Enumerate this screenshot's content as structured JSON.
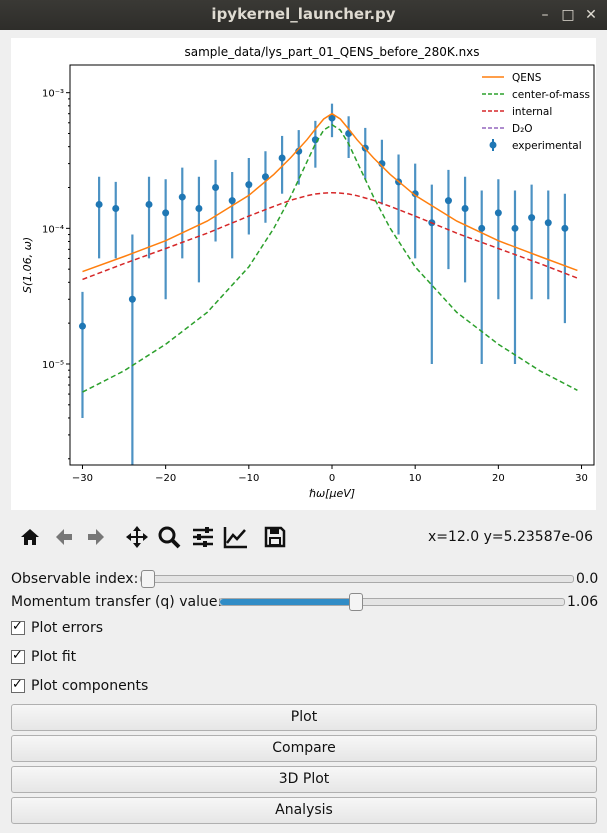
{
  "window": {
    "title": "ipykernel_launcher.py"
  },
  "plot": {
    "title": "sample_data/lys_part_01_QENS_before_280K.nxs",
    "xlabel": "ℏω[μeV]",
    "ylabel": "S(1.06, ω)",
    "legend": [
      {
        "label": "QENS",
        "color": "#ff7f0e",
        "style": "solid"
      },
      {
        "label": "center-of-mass",
        "color": "#2ca02c",
        "style": "dashed"
      },
      {
        "label": "internal",
        "color": "#d62728",
        "style": "dashed"
      },
      {
        "label": "D₂O",
        "color": "#9467bd",
        "style": "dashed"
      },
      {
        "label": "experimental",
        "color": "#1f77b4",
        "style": "marker"
      }
    ],
    "xticks": [
      "−30",
      "−20",
      "−10",
      "0",
      "10",
      "20",
      "30"
    ],
    "yticks": [
      "10⁻³",
      "10⁻⁴",
      "10⁻⁵"
    ]
  },
  "chart_data": {
    "type": "scatter",
    "title": "sample_data/lys_part_01_QENS_before_280K.nxs",
    "xlabel": "ℏω[μeV]",
    "ylabel": "S(1.06, ω)",
    "yscale": "log",
    "xlim": [
      -31.5,
      31.5
    ],
    "ylim": [
      1.8e-06,
      0.0016
    ],
    "grid": false,
    "legend_position": "top-right",
    "series": [
      {
        "name": "QENS",
        "kind": "line",
        "x": [
          -30,
          -25,
          -20,
          -15,
          -10,
          -7,
          -5,
          -3,
          -2,
          -1,
          0,
          1,
          2,
          3,
          5,
          7,
          10,
          15,
          20,
          25,
          29.5
        ],
        "values": [
          4.8e-05,
          6.2e-05,
          8.1e-05,
          0.000113,
          0.000175,
          0.00025,
          0.00033,
          0.00045,
          0.00054,
          0.00064,
          0.0007,
          0.00064,
          0.00054,
          0.00045,
          0.00033,
          0.00025,
          0.000175,
          0.000113,
          8.1e-05,
          6.2e-05,
          4.9e-05
        ]
      },
      {
        "name": "center-of-mass",
        "kind": "line",
        "x": [
          -30,
          -25,
          -20,
          -15,
          -10,
          -7,
          -5,
          -3,
          -2,
          -1,
          0,
          1,
          2,
          3,
          5,
          7,
          10,
          15,
          20,
          25,
          29.5
        ],
        "values": [
          6.2e-06,
          8.9e-06,
          1.4e-05,
          2.4e-05,
          5.2e-05,
          0.0001,
          0.00017,
          0.00031,
          0.00042,
          0.00053,
          0.00058,
          0.00053,
          0.00042,
          0.00031,
          0.00017,
          0.0001,
          5.2e-05,
          2.4e-05,
          1.4e-05,
          8.9e-06,
          6.4e-06
        ]
      },
      {
        "name": "internal",
        "kind": "line",
        "x": [
          -30,
          -25,
          -20,
          -15,
          -10,
          -7,
          -5,
          -3,
          -2,
          -1,
          0,
          1,
          2,
          3,
          5,
          7,
          10,
          15,
          20,
          25,
          29.5
        ],
        "values": [
          4.2e-05,
          5.5e-05,
          7.1e-05,
          9.2e-05,
          0.000123,
          0.000145,
          0.000161,
          0.000174,
          0.000179,
          0.000182,
          0.000183,
          0.000182,
          0.000179,
          0.000174,
          0.000161,
          0.000145,
          0.000123,
          9.2e-05,
          7.1e-05,
          5.5e-05,
          4.3e-05
        ]
      },
      {
        "name": "experimental",
        "kind": "points_with_errors",
        "x": [
          -30,
          -28,
          -26,
          -24,
          -22,
          -20,
          -18,
          -16,
          -14,
          -12,
          -10,
          -8,
          -6,
          -4,
          -2,
          0,
          2,
          4,
          6,
          8,
          10,
          12,
          14,
          16,
          18,
          20,
          22,
          24,
          26,
          28
        ],
        "values": [
          1.9e-05,
          0.00015,
          0.00014,
          3e-05,
          0.00015,
          0.00013,
          0.00017,
          0.00014,
          0.0002,
          0.00016,
          0.00021,
          0.00024,
          0.00033,
          0.00037,
          0.00045,
          0.00065,
          0.0005,
          0.00039,
          0.0003,
          0.00022,
          0.00018,
          0.00011,
          0.00016,
          0.00014,
          0.0001,
          0.00013,
          0.0001,
          0.00012,
          0.00011,
          0.0001
        ],
        "errors": [
          1.5e-05,
          9e-05,
          8e-05,
          6e-05,
          9e-05,
          0.0001,
          0.00011,
          0.0001,
          0.00012,
          0.0001,
          0.00012,
          0.00013,
          0.00015,
          0.00016,
          0.00017,
          0.00018,
          0.00017,
          0.00016,
          0.00015,
          0.00013,
          0.00012,
          0.0001,
          0.00011,
          0.0001,
          9e-05,
          0.0001,
          9e-05,
          9e-05,
          8e-05,
          8e-05
        ]
      }
    ]
  },
  "toolbar": {
    "icons": [
      "home-icon",
      "back-arrow-icon",
      "forward-arrow-icon",
      "pan-icon",
      "zoom-icon",
      "configure-subplots-icon",
      "edit-axis-icon",
      "save-icon"
    ],
    "coords": "x=12.0 y=5.23587e-06"
  },
  "controls": {
    "observable_label": "Observable index:",
    "observable_value": "0.0",
    "observable_fraction": 0.0,
    "q_label": "Momentum transfer (q) value:",
    "q_value": "1.06",
    "q_fraction": 0.39,
    "plot_errors": "Plot errors",
    "plot_fit": "Plot fit",
    "plot_components": "Plot components",
    "accent": "#308cc6"
  },
  "buttons": {
    "plot": "Plot",
    "compare": "Compare",
    "plot3d": "3D Plot",
    "analysis": "Analysis"
  }
}
